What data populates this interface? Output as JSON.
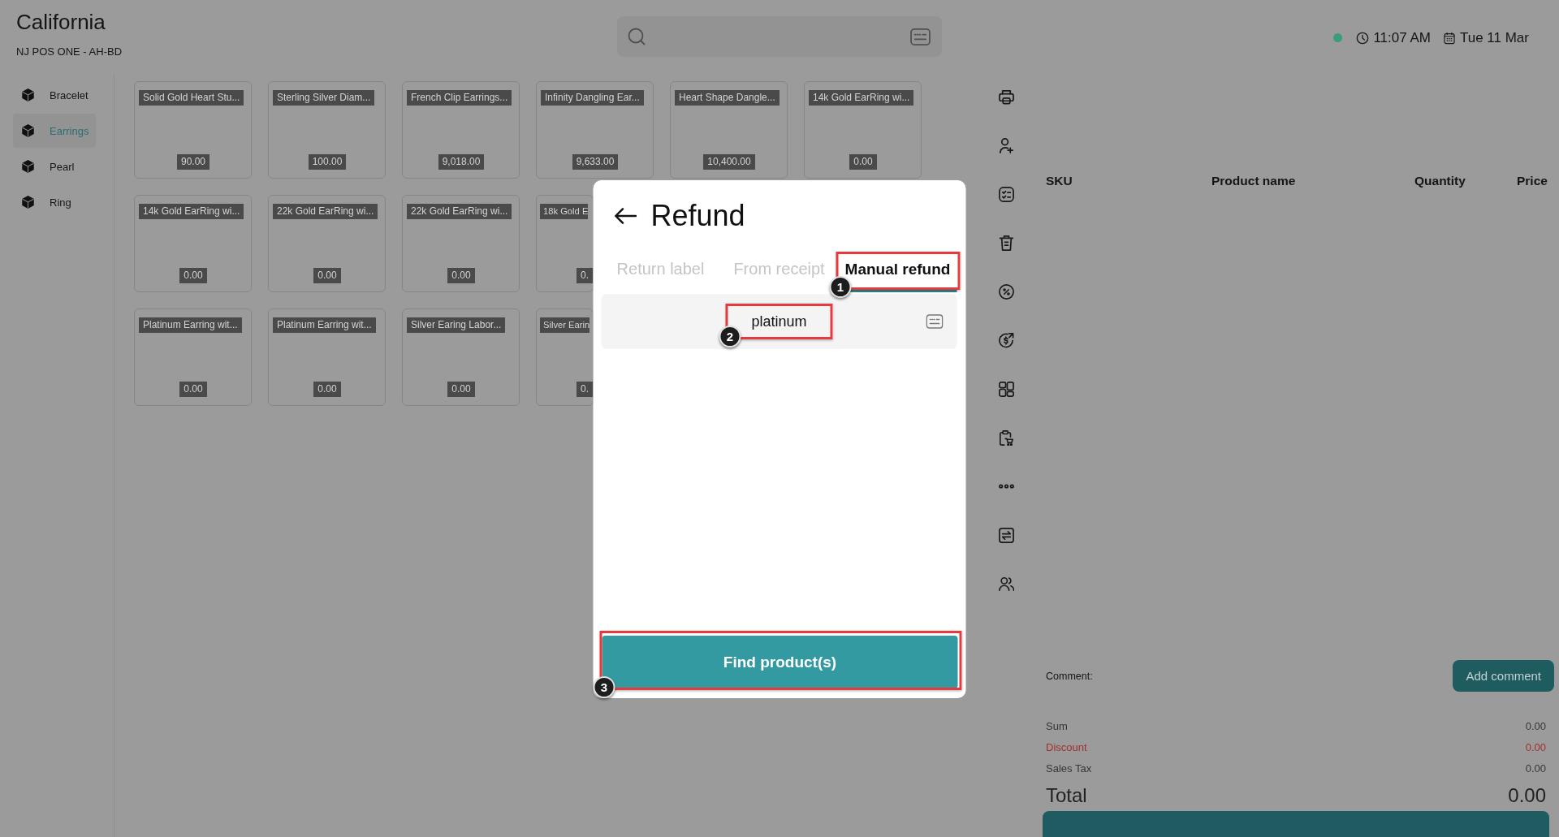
{
  "header": {
    "store": "California",
    "register": "NJ POS ONE - AH-BD"
  },
  "status": {
    "connected": true,
    "time": "11:07 AM",
    "date": "Tue 11 Mar"
  },
  "categories": [
    {
      "label": "Bracelet",
      "selected": false
    },
    {
      "label": "Earrings",
      "selected": true
    },
    {
      "label": "Pearl",
      "selected": false
    },
    {
      "label": "Ring",
      "selected": false
    }
  ],
  "product_grid": {
    "rows": [
      {
        "items": [
          {
            "name": "Solid Gold Heart Stu...",
            "price": "90.00"
          },
          {
            "name": "Sterling Silver Diam...",
            "price": "100.00"
          },
          {
            "name": "French Clip Earrings...",
            "price": "9,018.00"
          },
          {
            "name": "Infinity Dangling Ear...",
            "price": "9,633.00"
          },
          {
            "name": "Heart Shape Dangle...",
            "price": "10,400.00"
          },
          {
            "name": "14k Gold EarRing wi...",
            "price": "0.00"
          }
        ]
      },
      {
        "items": [
          {
            "name": "14k Gold EarRing wi...",
            "price": "0.00"
          },
          {
            "name": "22k Gold EarRing wi...",
            "price": "0.00"
          },
          {
            "name": "22k Gold EarRing wi...",
            "price": "0.00"
          },
          {
            "name": "18k Gold E",
            "price": "0."
          }
        ]
      },
      {
        "items": [
          {
            "name": "Platinum Earring wit...",
            "price": "0.00"
          },
          {
            "name": "Platinum Earring wit...",
            "price": "0.00"
          },
          {
            "name": "Silver Earing Labor...",
            "price": "0.00"
          },
          {
            "name": "Silver Earin",
            "price": "0."
          }
        ]
      }
    ]
  },
  "order_table": {
    "columns": [
      "SKU",
      "Product name",
      "Quantity",
      "Price"
    ]
  },
  "comment": {
    "label": "Comment:",
    "button": "Add comment"
  },
  "summary": [
    {
      "label": "Sum",
      "value": "0.00",
      "kind": "plain"
    },
    {
      "label": "Discount",
      "value": "0.00",
      "kind": "discount"
    },
    {
      "label": "Sales Tax",
      "value": "0.00",
      "kind": "plain"
    }
  ],
  "total": {
    "label": "Total",
    "value": "0.00"
  },
  "dialog": {
    "title": "Refund",
    "tabs": [
      {
        "label": "Return label",
        "selected": false
      },
      {
        "label": "From receipt",
        "selected": false
      },
      {
        "label": "Manual refund",
        "selected": true,
        "callout": "1"
      }
    ],
    "input": {
      "value": "platinum",
      "callout": "2"
    },
    "button": {
      "label": "Find product(s)",
      "callout": "3"
    }
  }
}
